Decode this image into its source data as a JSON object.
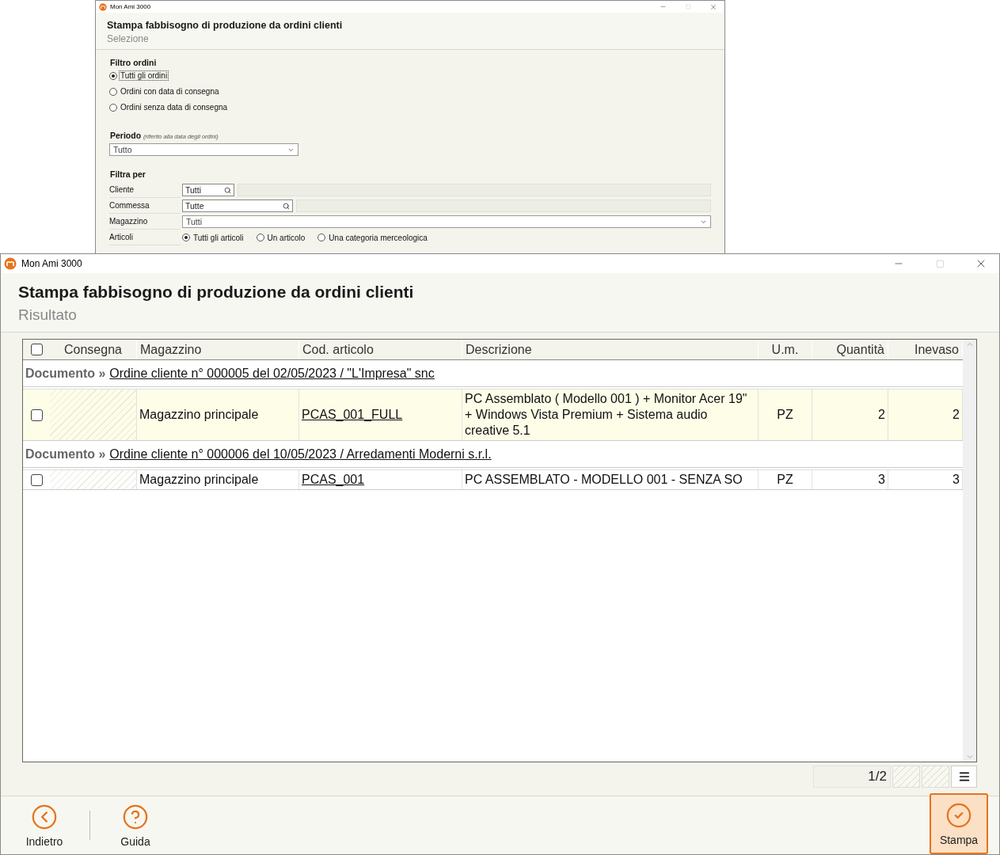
{
  "back_window": {
    "app_title": "Mon Ami 3000",
    "heading": "Stampa fabbisogno di produzione da ordini clienti",
    "subheading": "Selezione",
    "order_filter": {
      "label": "Filtro ordini",
      "options": [
        {
          "label": "Tutti gli ordini",
          "selected": true
        },
        {
          "label": "Ordini con data di consegna",
          "selected": false
        },
        {
          "label": "Ordini senza data di consegna",
          "selected": false
        }
      ]
    },
    "period": {
      "label": "Periodo",
      "note": "(riferito alla data degli ordini)",
      "value": "Tutto"
    },
    "filter_by": {
      "label": "Filtra per",
      "rows": [
        {
          "kind": "search",
          "label": "Cliente",
          "value": "Tutti"
        },
        {
          "kind": "search",
          "label": "Commessa",
          "value": "Tutte"
        },
        {
          "kind": "select",
          "label": "Magazzino",
          "value": "Tutti"
        },
        {
          "kind": "radio",
          "label": "Articoli",
          "options": [
            {
              "label": "Tutti gli articoli",
              "selected": true
            },
            {
              "label": "Un articolo",
              "selected": false
            },
            {
              "label": "Una categoria merceologica",
              "selected": false
            }
          ]
        }
      ]
    }
  },
  "front_window": {
    "app_title": "Mon Ami 3000",
    "heading": "Stampa fabbisogno di produzione da ordini clienti",
    "subheading": "Risultato",
    "table": {
      "header_checked": false,
      "columns": [
        "Consegna",
        "Magazzino",
        "Cod. articolo",
        "Descrizione",
        "U.m.",
        "Quantità",
        "Inevaso"
      ],
      "groups": [
        {
          "label": "Documento »",
          "document": "Ordine cliente n° 000005 del 02/05/2023 / \"L'Impresa\" snc",
          "rows": [
            {
              "checked": false,
              "selected": true,
              "warehouse": "Magazzino principale",
              "code": "PCAS_001_FULL",
              "description": "PC Assemblato ( Modello 001 ) + Monitor Acer 19\" + Windows Vista Premium + Sistema audio creative 5.1",
              "unit": "PZ",
              "quantity": "2",
              "open": "2"
            }
          ]
        },
        {
          "label": "Documento »",
          "document": "Ordine cliente n° 000006 del 10/05/2023 / Arredamenti Moderni s.r.l.",
          "rows": [
            {
              "checked": false,
              "selected": false,
              "warehouse": "Magazzino principale",
              "code": "PCAS_001",
              "description": "PC ASSEMBLATO - MODELLO 001 - SENZA SO",
              "unit": "PZ",
              "quantity": "3",
              "open": "3"
            }
          ]
        }
      ]
    },
    "pager": "1/2",
    "buttons": [
      {
        "kind": "back",
        "label": "Indietro"
      },
      {
        "kind": "help",
        "label": "Guida"
      },
      {
        "kind": "print",
        "label": "Stampa"
      }
    ]
  }
}
